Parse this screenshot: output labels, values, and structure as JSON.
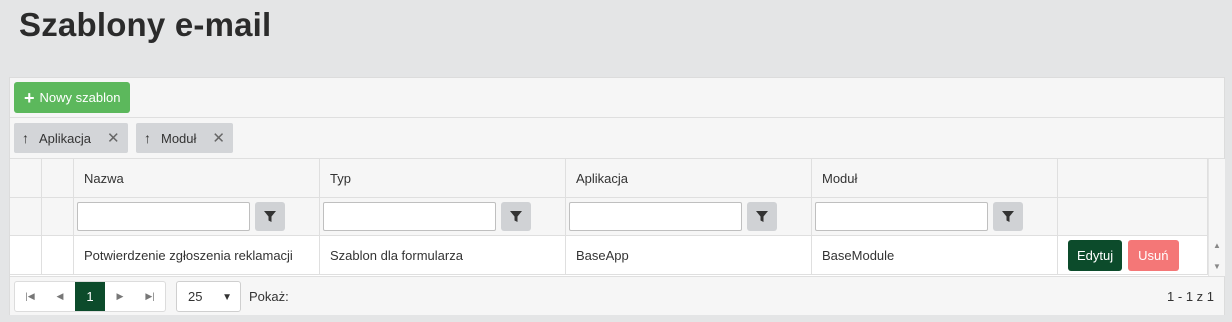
{
  "page": {
    "title": "Szablony e-mail"
  },
  "toolbar": {
    "new_label": "Nowy szablon"
  },
  "grouping": [
    {
      "label": "Aplikacja"
    },
    {
      "label": "Moduł"
    }
  ],
  "grid": {
    "columns": [
      "Nazwa",
      "Typ",
      "Aplikacja",
      "Moduł"
    ],
    "rows": [
      {
        "nazwa": "Potwierdzenie zgłoszenia reklamacji",
        "typ": "Szablon dla formularza",
        "aplikacja": "BaseApp",
        "modul": "BaseModule",
        "edit_label": "Edytuj",
        "delete_label": "Usuń"
      }
    ]
  },
  "pager": {
    "current_page": "1",
    "page_size": "25",
    "show_label": "Pokaż:",
    "info": "1 - 1 z 1"
  },
  "colors": {
    "primary": "#0c4b2b",
    "success": "#5cb85c",
    "danger": "#f47777"
  },
  "icons": [
    "plus-icon",
    "arrow-up-icon",
    "close-icon",
    "filter-icon",
    "first-page-icon",
    "prev-page-icon",
    "next-page-icon",
    "last-page-icon",
    "chevron-down-icon"
  ]
}
